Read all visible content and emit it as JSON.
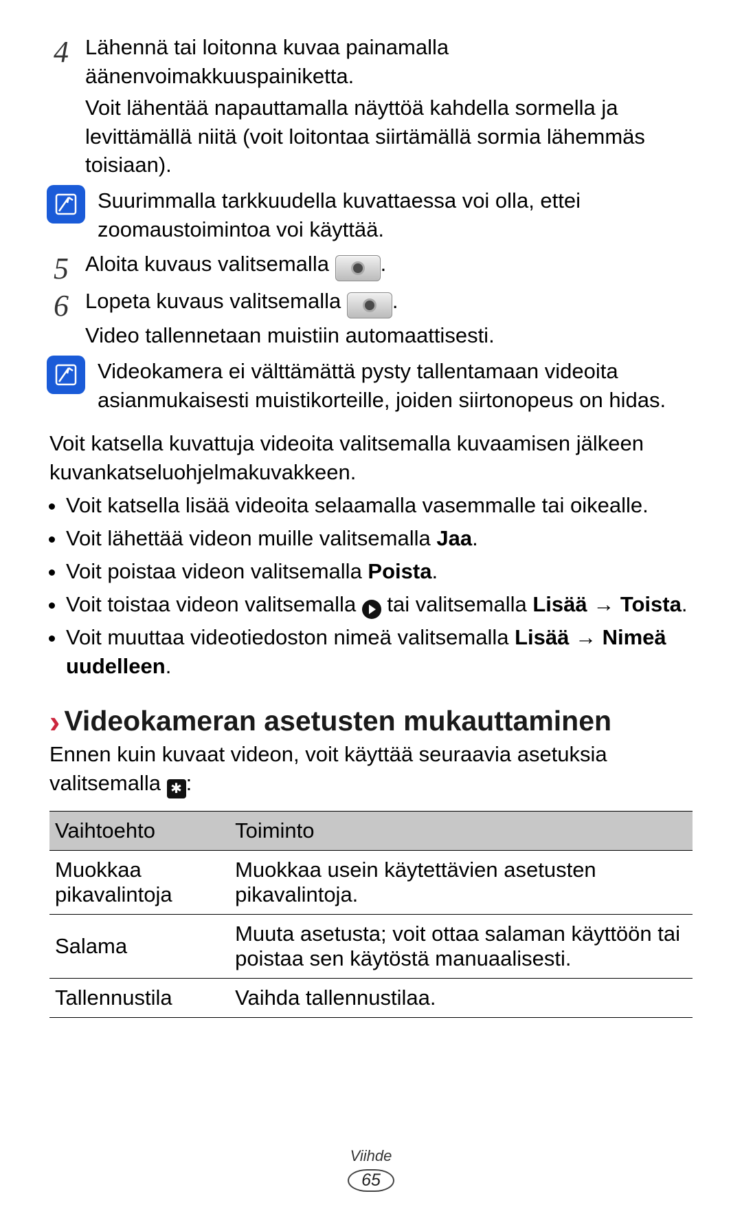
{
  "step4": {
    "num": "4",
    "line1": "Lähennä tai loitonna kuvaa painamalla äänenvoimakkuuspainiketta.",
    "line2": "Voit lähentää napauttamalla näyttöä kahdella sormella ja levittämällä niitä (voit loitontaa siirtämällä sormia lähemmäs toisiaan)."
  },
  "note1": "Suurimmalla tarkkuudella kuvattaessa voi olla, ettei zoomaustoimintoa voi käyttää.",
  "step5": {
    "num": "5",
    "pre": "Aloita kuvaus valitsemalla ",
    "post": "."
  },
  "step6": {
    "num": "6",
    "pre": "Lopeta kuvaus valitsemalla ",
    "post": ".",
    "line2": "Video tallennetaan muistiin automaattisesti."
  },
  "note2": "Videokamera ei välttämättä pysty tallentamaan videoita asianmukaisesti muistikorteille, joiden siirtonopeus on hidas.",
  "para1": "Voit katsella kuvattuja videoita valitsemalla kuvaamisen jälkeen kuvankatseluohjelmakuvakkeen.",
  "bullets": {
    "b1": "Voit katsella lisää videoita selaamalla vasemmalle tai oikealle.",
    "b2_pre": "Voit lähettää videon muille valitsemalla ",
    "b2_bold": "Jaa",
    "b2_post": ".",
    "b3_pre": "Voit poistaa videon valitsemalla ",
    "b3_bold": "Poista",
    "b3_post": ".",
    "b4_pre": "Voit toistaa videon valitsemalla ",
    "b4_mid": " tai valitsemalla ",
    "b4_lisaa": "Lisää",
    "b4_arrow": " → ",
    "b4_toista": "Toista",
    "b4_post": ".",
    "b5_pre": "Voit muuttaa videotiedoston nimeä valitsemalla ",
    "b5_lisaa": "Lisää",
    "b5_arrow": " → ",
    "b5_nimea": "Nimeä uudelleen",
    "b5_post": "."
  },
  "heading": "Videokameran asetusten mukauttaminen",
  "intro_pre": "Ennen kuin kuvaat videon, voit käyttää seuraavia asetuksia valitsemalla ",
  "intro_post": ":",
  "table": {
    "h1": "Vaihtoehto",
    "h2": "Toiminto",
    "r1c1": "Muokkaa pikavalintoja",
    "r1c2": "Muokkaa usein käytettävien asetusten pikavalintoja.",
    "r2c1": "Salama",
    "r2c2": "Muuta asetusta; voit ottaa salaman käyttöön tai poistaa sen käytöstä manuaalisesti.",
    "r3c1": "Tallennustila",
    "r3c2": "Vaihda tallennustilaa."
  },
  "footer": {
    "label": "Viihde",
    "page": "65"
  }
}
